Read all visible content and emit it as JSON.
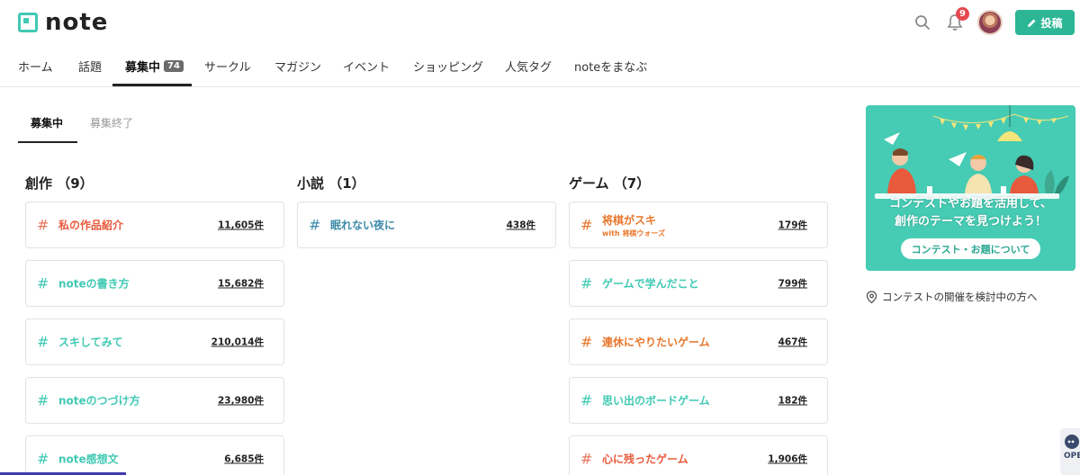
{
  "header": {
    "logo_text": "note",
    "notification_count": "9",
    "post_label": "投稿"
  },
  "nav": {
    "items": [
      "ホーム",
      "話題",
      "募集中",
      "サークル",
      "マガジン",
      "イベント",
      "ショッピング",
      "人気タグ",
      "noteをまなぶ"
    ],
    "active_count": "74"
  },
  "subtabs": [
    "募集中",
    "募集終了"
  ],
  "columns": [
    {
      "heading": "創作 （9）",
      "cards": [
        {
          "name": "私の作品紹介",
          "count": "11,605件",
          "color": "#e85a3c"
        },
        {
          "name": "noteの書き方",
          "count": "15,682件",
          "color": "#41c9b4"
        },
        {
          "name": "スキしてみて",
          "count": "210,014件",
          "color": "#41c9b4"
        },
        {
          "name": "noteのつづけ方",
          "count": "23,980件",
          "color": "#41c9b4"
        },
        {
          "name": "note感想文",
          "count": "6,685件",
          "color": "#41c9b4"
        }
      ]
    },
    {
      "heading": "小説 （1）",
      "cards": [
        {
          "name": "眠れない夜に",
          "count": "438件",
          "color": "#3d8aa8"
        }
      ]
    },
    {
      "heading": "ゲーム （7）",
      "cards": [
        {
          "name": "将棋がスキ",
          "sub": "with 将棋ウォーズ",
          "count": "179件",
          "color": "#e8762b"
        },
        {
          "name": "ゲームで学んだこと",
          "count": "799件",
          "color": "#41c9b4"
        },
        {
          "name": "連休にやりたいゲーム",
          "count": "467件",
          "color": "#e8762b"
        },
        {
          "name": "思い出のボードゲーム",
          "count": "182件",
          "color": "#41c9b4"
        },
        {
          "name": "心に残ったゲーム",
          "count": "1,906件",
          "color": "#e85a3c"
        }
      ]
    }
  ],
  "sidebar": {
    "banner_line1": "コンテストやお題を活用して、",
    "banner_line2": "創作のテーマを見つけよう！",
    "banner_button": "コンテスト・お題について",
    "link_text": "コンテストの開催を検討中の方へ"
  },
  "corner_label": "OPE"
}
